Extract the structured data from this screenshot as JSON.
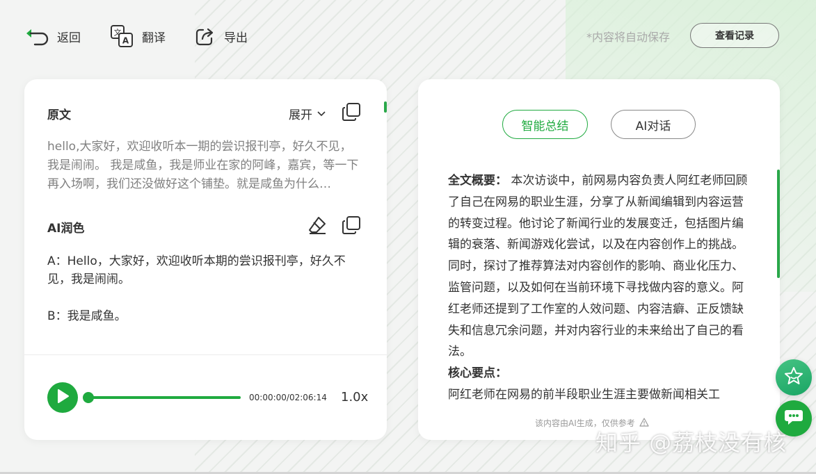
{
  "toolbar": {
    "back_label": "返回",
    "translate_label": "翻译",
    "export_label": "导出",
    "autosave_text": "*内容将自动保存",
    "record_button": "查看记录"
  },
  "original": {
    "title": "原文",
    "expand_label": "展开",
    "text": "hello,大家好，欢迎收听本一期的尝识报刊亭，好久不见，我是闹闹。 我是咸鱼，我是师业在家的阿峰，嘉宾，等一下再入场啊，我们还没做好这个铺垫。就是咸鱼为什么…"
  },
  "polish": {
    "title": "AI润色",
    "line_a": "A：Hello，大家好，欢迎收听本期的尝识报刊亭，好久不见，我是闹闹。",
    "line_b": "B：我是咸鱼。"
  },
  "player": {
    "time": "00:00:00/02:06:14",
    "speed": "1.0x",
    "progress": 0
  },
  "tabs": {
    "summary": "智能总结",
    "chat": "AI对话"
  },
  "summary": {
    "overview_label": "全文概要：",
    "overview_text": " 本次访谈中，前网易内容负责人阿红老师回顾了自己在网易的职业生涯，分享了从新闻编辑到内容运营的转变过程。他讨论了新闻行业的发展变迁，包括图片编辑的衰落、新闻游戏化尝试，以及在内容创作上的挑战。同时，探讨了推荐算法对内容创作的影响、商业化压力、监管问题，以及如何在当前环境下寻找做内容的意义。阿红老师还提到了工作室的人效问题、内容洁癖、正反馈缺失和信息冗余问题，并对内容行业的未来给出了自己的看法。",
    "key_label": "核心要点：",
    "key_text": "阿红老师在网易的前半段职业生涯主要做新闻相关工",
    "disclaimer": "该内容由AI生成，仅供参考"
  },
  "watermark": "知乎 @荔枝没有核",
  "colors": {
    "accent": "#1faa3f",
    "background": "#f3f4f3"
  }
}
